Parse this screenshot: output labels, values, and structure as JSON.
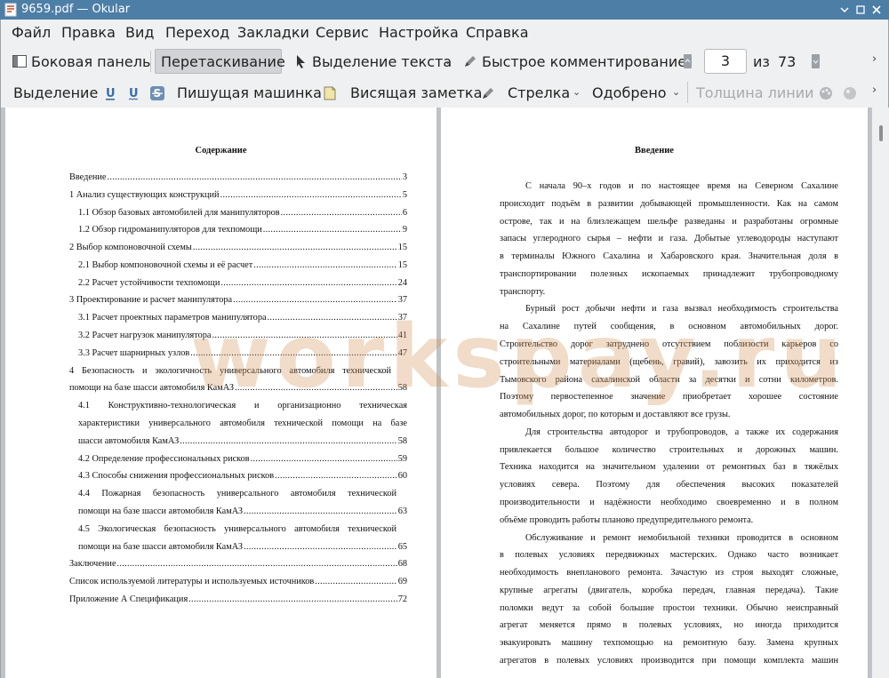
{
  "window": {
    "title": "9659.pdf  — Okular"
  },
  "menubar": [
    "Файл",
    "Правка",
    "Вид",
    "Переход",
    "Закладки",
    "Сервис",
    "Настройка",
    "Справка"
  ],
  "toolbar1": {
    "sidebar": "Боковая панель",
    "drag": "Перетаскивание",
    "text_select": "Выделение текста",
    "quick_comment": "Быстрое комментирование",
    "page_current": "3",
    "page_of": "из",
    "page_total": "73"
  },
  "toolbar2": {
    "highlight": "Выделение",
    "typewriter": "Пишущая машинка",
    "hanging_note": "Висящая заметка",
    "arrow": "Стрелка",
    "approved": "Одобрено",
    "line_width": "Толщина линии"
  },
  "watermark": "workspay.ru",
  "left_page": {
    "title": "Содержание",
    "toc": [
      {
        "text": "Введение",
        "page": "3"
      },
      {
        "text": "1 Анализ существующих конструкций",
        "page": "5"
      },
      {
        "text": "1.1 Обзор базовых автомобилей для манипуляторов",
        "page": "6"
      },
      {
        "text": "1.2 Обзор гидроманипуляторов для техпомощи",
        "page": "9"
      },
      {
        "text": "2 Выбор компоновочной схемы",
        "page": "15"
      },
      {
        "text": "2.1 Выбор компоновочной схемы и её расчет",
        "page": "15"
      },
      {
        "text": "2.2 Расчет устойчивости техпомощи",
        "page": "24"
      },
      {
        "text": "3 Проектирование и расчет манипулятора",
        "page": "37"
      },
      {
        "text": "3.1 Расчет проектных параметров манипулятора",
        "page": "37"
      },
      {
        "text": "3.2 Расчет нагрузок манипулятора",
        "page": "41"
      },
      {
        "text": "3.3 Расчет шарнирных узлов",
        "page": "47"
      },
      {
        "text_l1": "4 Безопасность и экологичность универсального автомобиля технической",
        "text_l2": "помощи на базе шасси автомобиля КамАЗ",
        "page": "58"
      },
      {
        "text_l1": "4.1 Конструктивно-технологическая и организационно техническая",
        "text_l2": "характеристики универсального автомобиля технической помощи на базе",
        "text_l3": "шасси автомобиля КамАЗ",
        "page": "58"
      },
      {
        "text": "4.2 Определение профессиональных рисков",
        "page": "59"
      },
      {
        "text": "4.3 Способы снижения профессиональных рисков",
        "page": "60"
      },
      {
        "text_l1": "4.4 Пожарная безопасность универсального автомобиля технической",
        "text_l2": "помощи на базе шасси автомобиля КамАЗ",
        "page": "63"
      },
      {
        "text_l1": "4.5 Экологическая безопасность универсального автомобиля технической",
        "text_l2": "помощи на базе шасси автомобиля КамАЗ",
        "page": "65"
      },
      {
        "text": "Заключение",
        "page": "68"
      },
      {
        "text": "Список используемой литературы и используемых источников",
        "page": "69"
      },
      {
        "text": "Приложение А Спецификация",
        "page": "72"
      }
    ]
  },
  "right_page": {
    "title": "Введение",
    "lines": [
      "С начала 90–х годов и по настоящее время на Северном Сахалине",
      "происходит подъём в развитии добывающей промышленности. Как на самом",
      "острове, так и на близлежащем шельфе разведаны и разработаны огромные",
      "запасы углеродного сырья – нефти и газа. Добытые углеводороды наступают",
      "в терминалы Южного Сахалина и Хабаровского края. Значительная доля в",
      "транспортировании полезных ископаемых принадлежит трубопроводному",
      "транспорту.",
      "Бурный рост добычи нефти и газа вызвал необходимость строительства",
      "на Сахалине путей сообщения, в основном автомобильных дорог.",
      "Строительство дорог затруднено отсутствием поблизости карьеров со",
      "строительными материалами (щебень, гравий), завозить их приходится из",
      "Тымовского района сахалинской области за десятки и сотни километров.",
      "Поэтому первостепенное значение приобретает хорошее состояние",
      "автомобильных дорог, по которым и доставляют все грузы.",
      "Для строительства автодорог и трубопроводов, а также их содержания",
      "привлекается большое количество строительных и дорожных машин.",
      "Техника находится на значительном удалении от ремонтных баз в тяжёлых",
      "условиях севера. Поэтому для обеспечения высоких показателей",
      "производительности и надёжности необходимо своевременно и в полном",
      "объёме проводить работы планово предупредительного ремонта.",
      "Обслуживание и ремонт немобильной техники проводится в основном",
      "в полевых условиях передвижных мастерских. Однако часто возникает",
      "необходимость внепланового ремонта. Зачастую из строя выходят сложные,",
      "крупные агрегаты (двигатель, коробка передач, главная передача). Такие",
      "поломки ведут за собой большие простои техники. Обычно неисправный",
      "агрегат меняется прямо в полевых условиях, но иногда приходится",
      "эвакуировать машину техпомощью на ремонтную базу. Замена крупных",
      "агрегатов в полевых условиях производится при помощи комплекта машин"
    ]
  }
}
